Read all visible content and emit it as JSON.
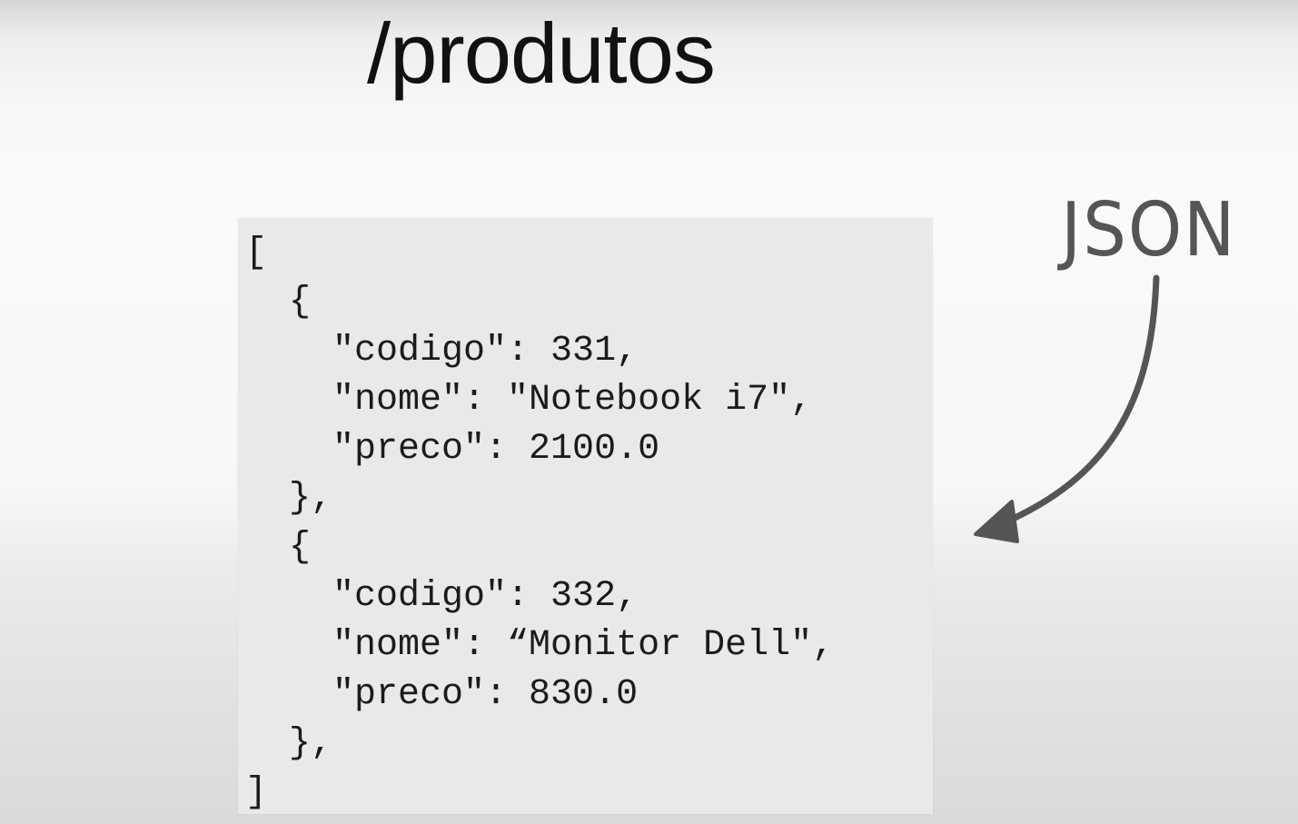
{
  "slide": {
    "title": "/produtos",
    "annotation_label": "JSON",
    "arrow_icon": "curved-arrow-icon",
    "colors": {
      "code_background": "#e9e9e9",
      "annotation": "#555555"
    }
  },
  "code": {
    "lines": [
      "[",
      "  {",
      "    \"codigo\": 331,",
      "    \"nome\": \"Notebook i7\",",
      "    \"preco\": 2100.0",
      "  },",
      "  {",
      "    \"codigo\": 332,",
      "    \"nome\": “Monitor Dell\",",
      "    \"preco\": 830.0",
      "  },",
      "]"
    ]
  }
}
